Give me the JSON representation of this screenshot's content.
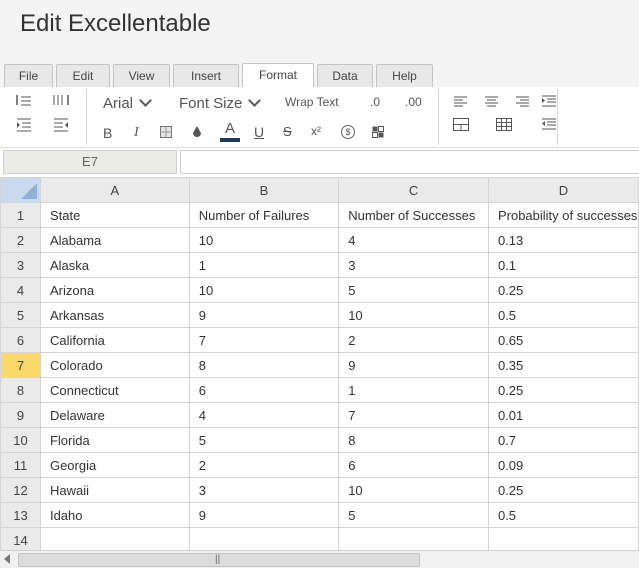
{
  "app": {
    "title": "Edit Excellentable"
  },
  "tabs": [
    {
      "label": "File"
    },
    {
      "label": "Edit"
    },
    {
      "label": "View"
    },
    {
      "label": "Insert"
    },
    {
      "label": "Format"
    },
    {
      "label": "Data"
    },
    {
      "label": "Help"
    }
  ],
  "active_tab": "Format",
  "ribbon": {
    "font_family": "Arial",
    "font_size": "Font Size",
    "wrap_text": "Wrap Text",
    "decimal_decrease": ".0",
    "decimal_increase": ".00",
    "bold": "B",
    "italic": "I",
    "font_color": "A",
    "underline": "U",
    "strikethrough": "S",
    "superscript": "x²",
    "currency": "$"
  },
  "formula_bar": {
    "cell_ref": "E7",
    "value": ""
  },
  "sheet": {
    "columns": [
      "A",
      "B",
      "C",
      "D"
    ],
    "selected_row": 7,
    "rows": [
      {
        "num": "1",
        "cells": [
          "State",
          "Number of Failures",
          "Number of Successes",
          "Probability of successes"
        ]
      },
      {
        "num": "2",
        "cells": [
          "Alabama",
          "10",
          "4",
          "0.13"
        ]
      },
      {
        "num": "3",
        "cells": [
          "Alaska",
          "1",
          "3",
          "0.1"
        ]
      },
      {
        "num": "4",
        "cells": [
          "Arizona",
          "10",
          "5",
          "0.25"
        ]
      },
      {
        "num": "5",
        "cells": [
          "Arkansas",
          "9",
          "10",
          "0.5"
        ]
      },
      {
        "num": "6",
        "cells": [
          "California",
          "7",
          "2",
          "0.65"
        ]
      },
      {
        "num": "7",
        "cells": [
          "Colorado",
          "8",
          "9",
          "0.35"
        ]
      },
      {
        "num": "8",
        "cells": [
          "Connecticut",
          "6",
          "1",
          "0.25"
        ]
      },
      {
        "num": "9",
        "cells": [
          "Delaware",
          "4",
          "7",
          "0.01"
        ]
      },
      {
        "num": "10",
        "cells": [
          "Florida",
          "5",
          "8",
          "0.7"
        ]
      },
      {
        "num": "11",
        "cells": [
          "Georgia",
          "2",
          "6",
          "0.09"
        ]
      },
      {
        "num": "12",
        "cells": [
          "Hawaii",
          "3",
          "10",
          "0.25"
        ]
      },
      {
        "num": "13",
        "cells": [
          "Idaho",
          "9",
          "5",
          "0.5"
        ]
      },
      {
        "num": "14",
        "cells": [
          "",
          "",
          "",
          ""
        ]
      }
    ]
  },
  "colors": {
    "selected_row_header": "#fbd86a",
    "corner": "#c9d9ee",
    "font_color_bar": "#1a3a5c"
  }
}
